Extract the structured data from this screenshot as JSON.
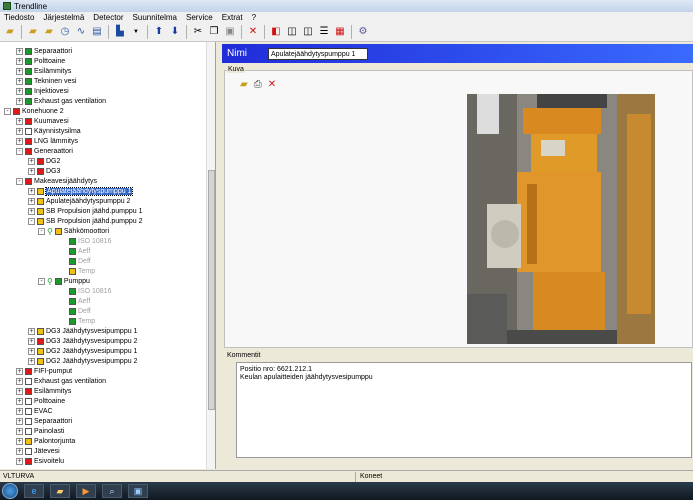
{
  "window": {
    "title": "Trendline"
  },
  "menu": [
    "Tiedosto",
    "Järjestelmä",
    "Detector",
    "Suunnitelma",
    "Service",
    "Extrat",
    "?"
  ],
  "tree": [
    {
      "label": "Separaattori",
      "color": "green",
      "level": 2,
      "exp": "+"
    },
    {
      "label": "Polttoaine",
      "color": "green",
      "level": 2,
      "exp": "+"
    },
    {
      "label": "Esilämmitys",
      "color": "green",
      "level": 2,
      "exp": "+"
    },
    {
      "label": "Tekninen vesi",
      "color": "green",
      "level": 2,
      "exp": "+"
    },
    {
      "label": "Injektiovesi",
      "color": "green",
      "level": 2,
      "exp": "+"
    },
    {
      "label": "Exhaust gas ventilation",
      "color": "green",
      "level": 2,
      "exp": "+"
    },
    {
      "label": "Konehuone 2",
      "color": "red",
      "level": 1,
      "exp": "-"
    },
    {
      "label": "Kuumavesi",
      "color": "red",
      "level": 2,
      "exp": "+"
    },
    {
      "label": "Käynnistysilma",
      "color": "white",
      "level": 2,
      "exp": "+"
    },
    {
      "label": "LNG lämmitys",
      "color": "red",
      "level": 2,
      "exp": "+"
    },
    {
      "label": "Generaattori",
      "color": "red",
      "level": 2,
      "exp": "-"
    },
    {
      "label": "DG2",
      "color": "red",
      "level": 3,
      "exp": "+"
    },
    {
      "label": "DG3",
      "color": "red",
      "level": 3,
      "exp": "+"
    },
    {
      "label": "Makeavesijäähdytys",
      "color": "red",
      "level": 2,
      "exp": "-"
    },
    {
      "label": "Apulatejäähdytyspumppu 1",
      "color": "yellow",
      "level": 3,
      "exp": "+",
      "selected": true
    },
    {
      "label": "Apulatejäähdytyspumppu 2",
      "color": "yellow",
      "level": 3,
      "exp": "+"
    },
    {
      "label": "SB Propulsion jäähd.pumppu 1",
      "color": "yellow",
      "level": 3,
      "exp": "+"
    },
    {
      "label": "SB Propulsion jäähd.pumppu 2",
      "color": "yellow",
      "level": 3,
      "exp": "-"
    },
    {
      "label": "Sähkömoottori",
      "color": "yellow",
      "level": 4,
      "exp": "-",
      "motor": true
    },
    {
      "label": "ISO 10816",
      "color": "green",
      "level": 5,
      "grey": true
    },
    {
      "label": "Aeff",
      "color": "green",
      "level": 5,
      "grey": true
    },
    {
      "label": "Deff",
      "color": "green",
      "level": 5,
      "grey": true
    },
    {
      "label": "Temp",
      "color": "yellow",
      "level": 5,
      "grey": true
    },
    {
      "label": "Pumppu",
      "color": "green",
      "level": 4,
      "exp": "-",
      "motor": true
    },
    {
      "label": "ISO 10816",
      "color": "green",
      "level": 5,
      "grey": true
    },
    {
      "label": "Aeff",
      "color": "green",
      "level": 5,
      "grey": true
    },
    {
      "label": "Deff",
      "color": "green",
      "level": 5,
      "grey": true
    },
    {
      "label": "Temp",
      "color": "green",
      "level": 5,
      "grey": true
    },
    {
      "label": "DG3 Jäähdytysvesipumppu 1",
      "color": "yellow",
      "level": 3,
      "exp": "+"
    },
    {
      "label": "DG3 Jäähdytysvesipumppu 2",
      "color": "red",
      "level": 3,
      "exp": "+"
    },
    {
      "label": "DG2 Jäähdytysvesipumppu 1",
      "color": "yellow",
      "level": 3,
      "exp": "+"
    },
    {
      "label": "DG2 Jäähdytysvesipumppu 2",
      "color": "yellow",
      "level": 3,
      "exp": "+"
    },
    {
      "label": "FIFI-pumput",
      "color": "red",
      "level": 2,
      "exp": "+"
    },
    {
      "label": "Exhaust gas ventilation",
      "color": "white",
      "level": 2,
      "exp": "+"
    },
    {
      "label": "Esilämmitys",
      "color": "red",
      "level": 2,
      "exp": "+"
    },
    {
      "label": "Polttoaine",
      "color": "white",
      "level": 2,
      "exp": "+"
    },
    {
      "label": "EVAC",
      "color": "white",
      "level": 2,
      "exp": "+"
    },
    {
      "label": "Separaattori",
      "color": "white",
      "level": 2,
      "exp": "+"
    },
    {
      "label": "Painolasti",
      "color": "white",
      "level": 2,
      "exp": "+"
    },
    {
      "label": "Palontorjunta",
      "color": "yellow",
      "level": 2,
      "exp": "+"
    },
    {
      "label": "Jätevesi",
      "color": "white",
      "level": 2,
      "exp": "+"
    },
    {
      "label": "Esivoitelu",
      "color": "red",
      "level": 2,
      "exp": "+"
    }
  ],
  "detail": {
    "name_label": "Nimi",
    "name_value": "Apulatejäähdytyspumppu 1",
    "image_group_label": "Kuva",
    "comment_label": "Kommentit",
    "comment_lines": [
      "Positio nro: 6621.212.1",
      "Keulan apulaitteiden jäähdytysvesipumppu"
    ]
  },
  "status": {
    "left": "VLTURVA",
    "right": "Koneet"
  },
  "colors": {
    "green": "#1a9a2a",
    "red": "#e01818",
    "yellow": "#f2c010",
    "white": "#ffffff",
    "name_bar": "#1f2cd8"
  }
}
